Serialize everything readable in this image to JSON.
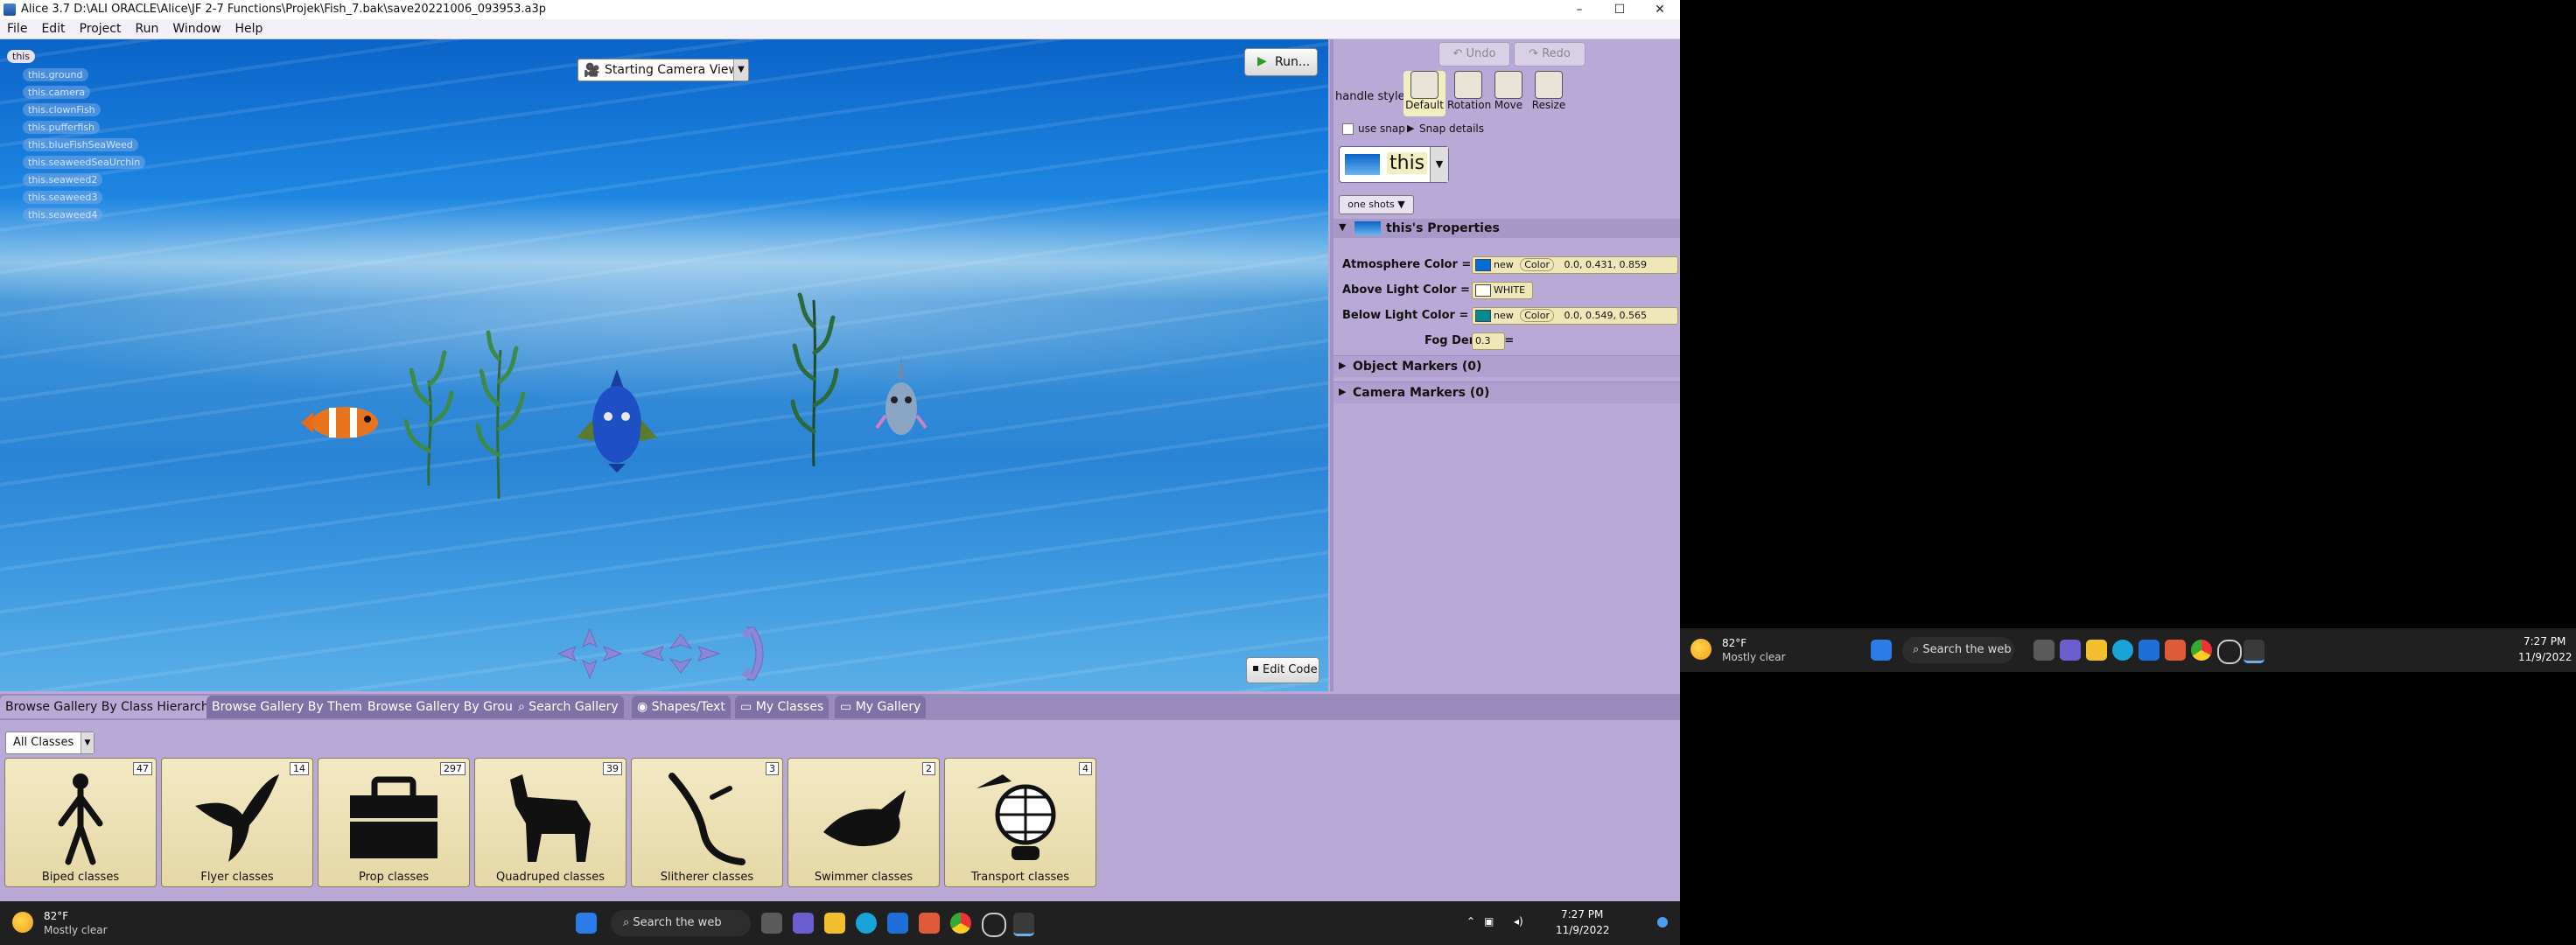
{
  "window": {
    "title": "Alice 3.7 D:\\ALI ORACLE\\Alice\\JF 2-7 Functions\\Projek\\Fish_7.bak\\save20221006_093953.a3p",
    "controls": [
      "–",
      "☐",
      "✕"
    ]
  },
  "menu": [
    "File",
    "Edit",
    "Project",
    "Run",
    "Window",
    "Help"
  ],
  "scene": {
    "tree_root": "this",
    "tree_items": [
      "this.ground",
      "this.camera",
      "this.clownFish",
      "this.pufferfish",
      "this.blueFishSeaWeed",
      "this.seaweedSeaUrchin",
      "this.seaweed2",
      "this.seaweed3",
      "this.seaweed4"
    ],
    "camera_selector": "Starting Camera View",
    "run_button": "Run...",
    "edit_code_button": "Edit Code"
  },
  "right_panel": {
    "undo": "Undo",
    "redo": "Redo",
    "handle_style_label": "handle style:",
    "handles": [
      "Default",
      "Rotation",
      "Move",
      "Resize"
    ],
    "use_snap": "use snap",
    "snap_details": "Snap details",
    "selected_object": "this",
    "one_shots": "one shots ▼",
    "properties_title": "this's Properties",
    "properties": {
      "atmosphere": {
        "label": "Atmosphere Color =",
        "new": "new",
        "color": "Color",
        "r": "0.0",
        "g": "0.431",
        "b": "0.859",
        "swatch": "#006edb"
      },
      "above_light": {
        "label": "Above Light Color =",
        "value": "WHITE",
        "swatch": "#ffffff"
      },
      "below_light": {
        "label": "Below Light Color =",
        "new": "new",
        "color": "Color",
        "r": "0.0",
        "g": "0.549",
        "b": "0.565",
        "swatch": "#008c90"
      },
      "fog": {
        "label": "Fog Density =",
        "value": "0.3"
      }
    },
    "object_markers": "Object Markers (0)",
    "camera_markers": "Camera Markers (0)"
  },
  "gallery": {
    "tabs": [
      "Browse Gallery By Class Hierarchy",
      "Browse Gallery By Theme",
      "Browse Gallery By Group",
      "Search Gallery",
      "Shapes/Text",
      "My Classes",
      "My Gallery"
    ],
    "class_filter": "All Classes",
    "cards": [
      {
        "name": "Biped classes",
        "count": "47"
      },
      {
        "name": "Flyer classes",
        "count": "14"
      },
      {
        "name": "Prop classes",
        "count": "297"
      },
      {
        "name": "Quadruped classes",
        "count": "39"
      },
      {
        "name": "Slitherer classes",
        "count": "3"
      },
      {
        "name": "Swimmer classes",
        "count": "2"
      },
      {
        "name": "Transport classes",
        "count": "4"
      }
    ]
  },
  "taskbar": {
    "weather_temp": "82°F",
    "weather_desc": "Mostly clear",
    "search": "Search the web",
    "time": "7:27 PM",
    "date": "11/9/2022"
  },
  "colors": {
    "panel": "#b9a9d6",
    "tab": "#9a8bbd",
    "taskbar": "#202020"
  }
}
